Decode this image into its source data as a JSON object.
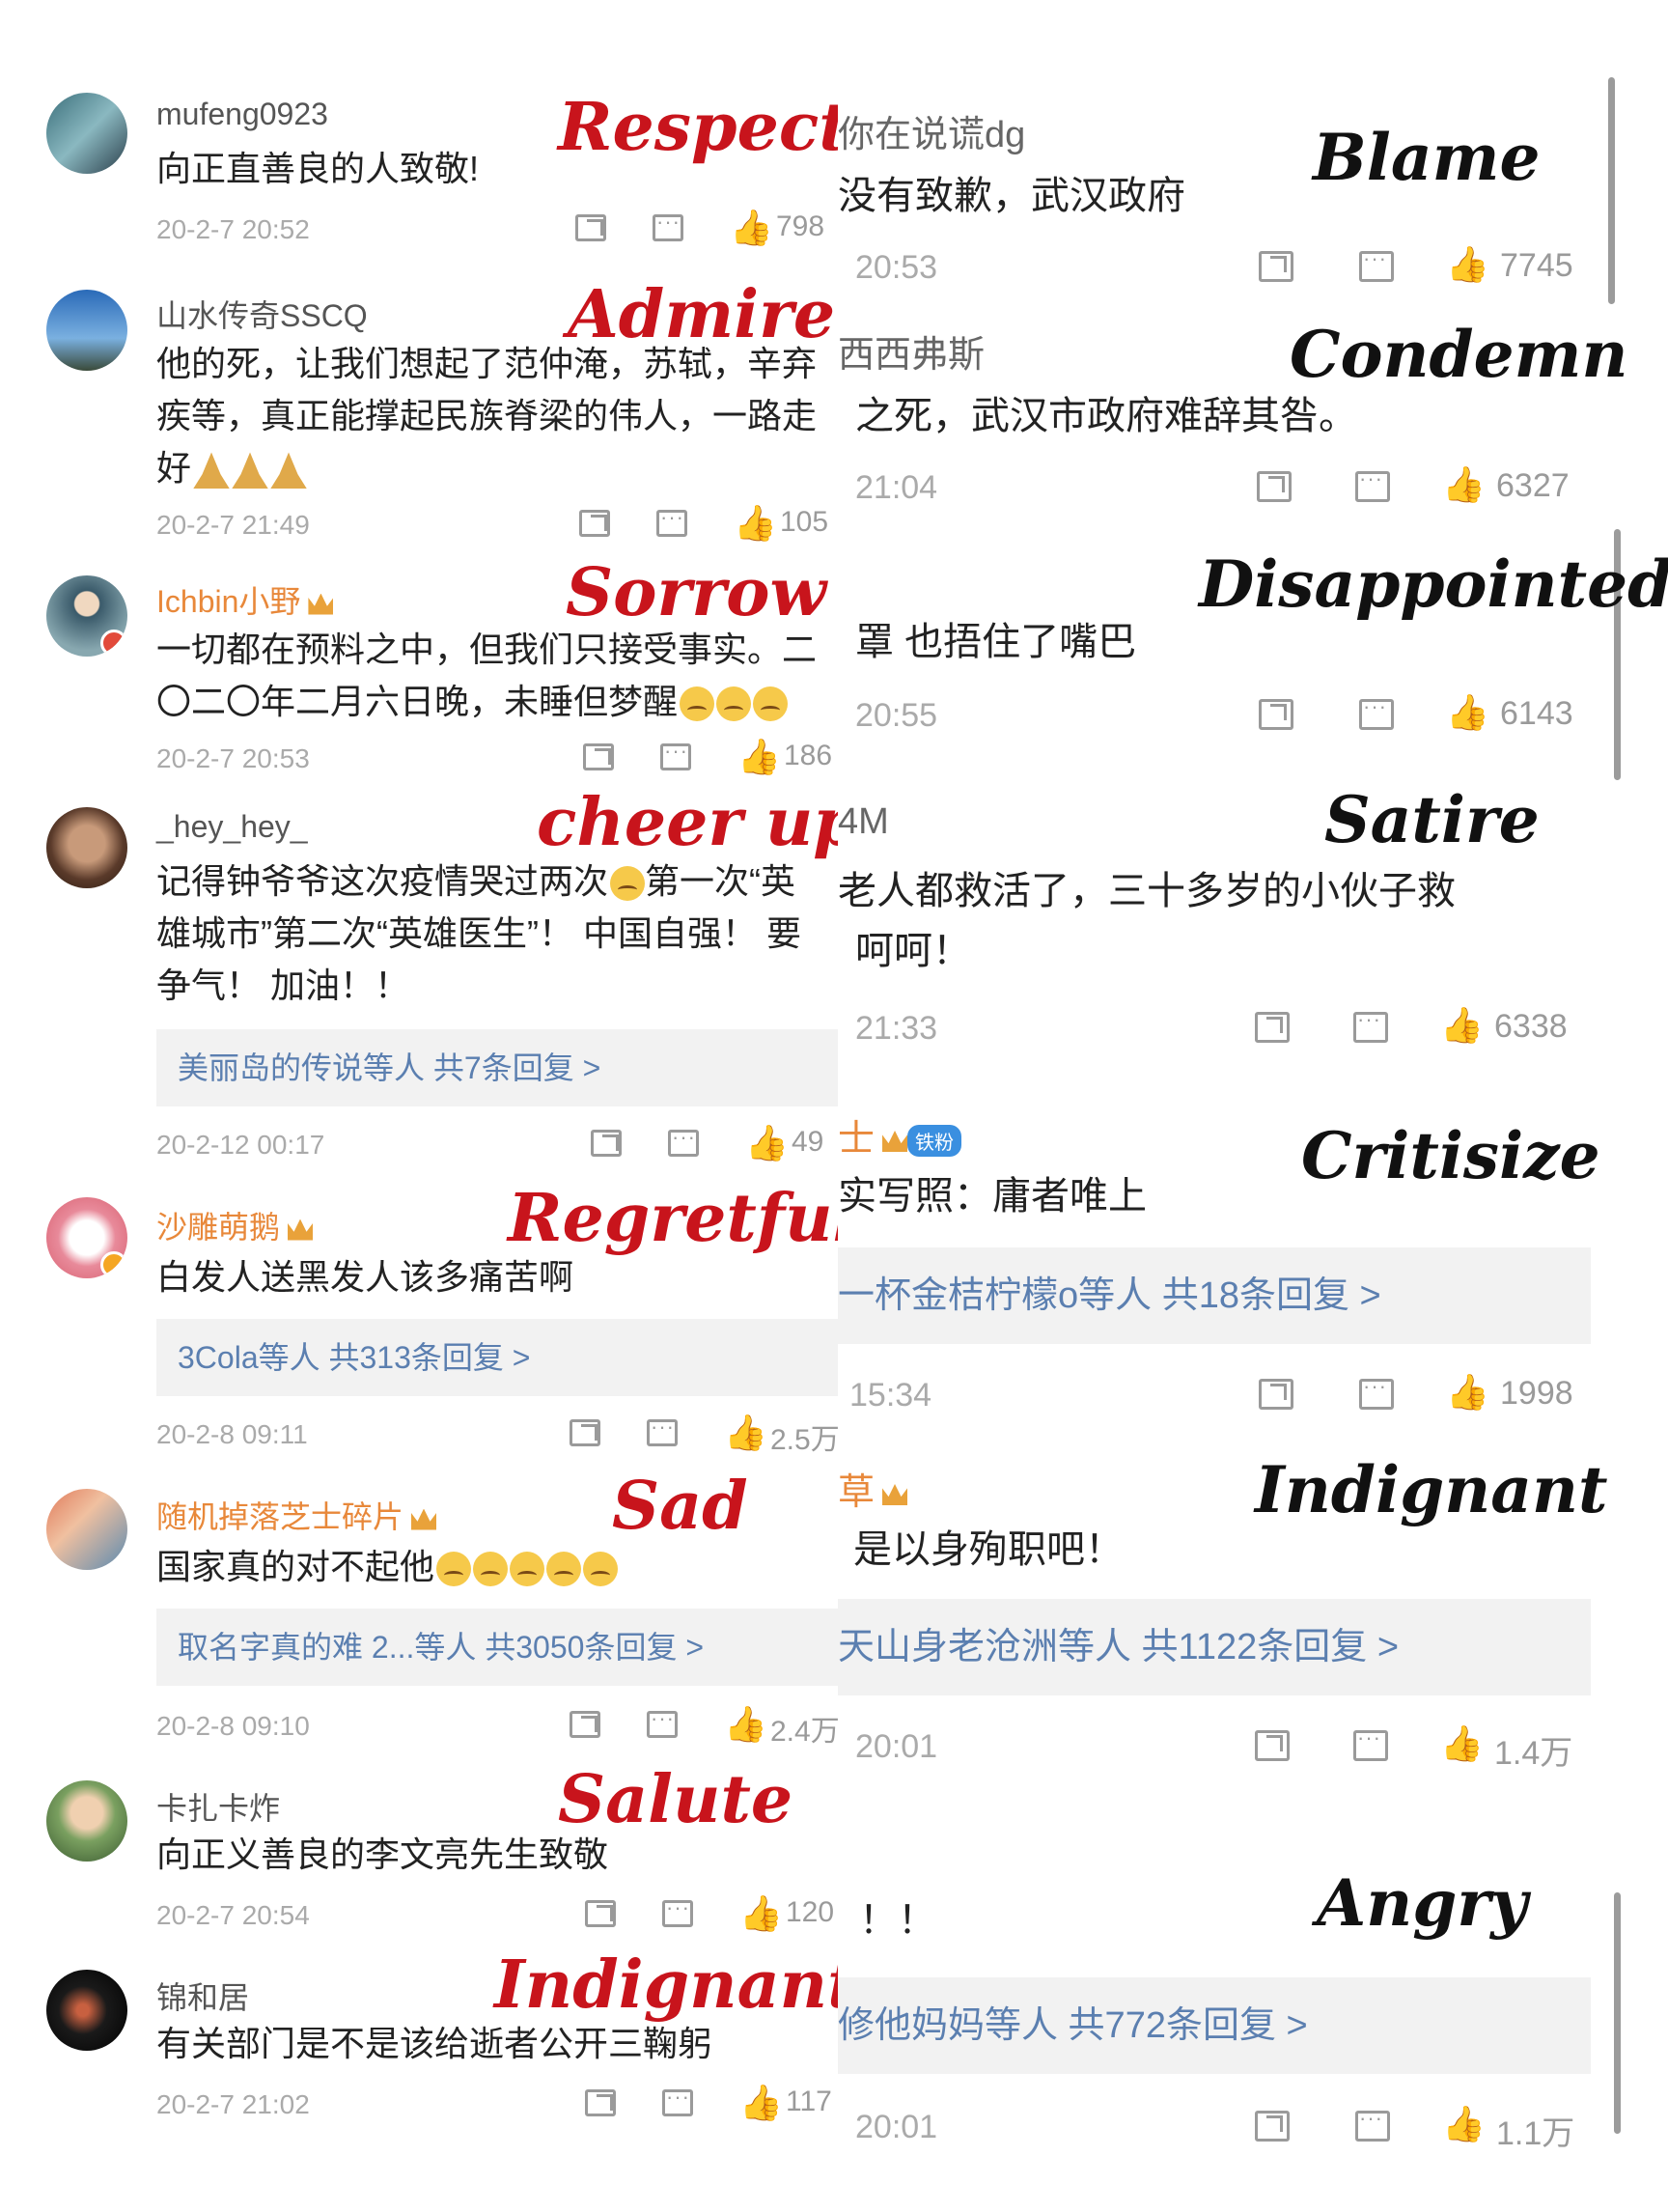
{
  "left": {
    "comments": [
      {
        "username": "mufeng0923",
        "text": "向正直善良的人致敬!",
        "time": "20-2-7 20:52",
        "likes": "798",
        "label": "Respect"
      },
      {
        "username": "山水传奇SSCQ",
        "text1": "他的死，让我们想起了范仲淹，苏轼，辛弃",
        "text2": "疾等，真正能撑起民族脊梁的伟人，一路走",
        "text3": "好",
        "time": "20-2-7 21:49",
        "likes": "105",
        "label": "Admire"
      },
      {
        "username": "Ichbin小野",
        "text1": "一切都在预料之中，但我们只接受事实。二",
        "text2": "〇二〇年二月六日晚，未睡但梦醒",
        "time": "20-2-7 20:53",
        "likes": "186",
        "label": "Sorrow"
      },
      {
        "username": "_hey_hey_",
        "text1": "记得钟爷爷这次疫情哭过两次",
        "text1b": "第一次“英",
        "text2": "雄城市”第二次“英雄医生”！ 中国自强！ 要",
        "text3": "争气！ 加油！！",
        "reply": "美丽岛的传说等人  共7条回复 >",
        "time": "20-2-12 00:17",
        "likes": "49",
        "label": "cheer up"
      },
      {
        "username": "沙雕萌鹅",
        "text": "白发人送黑发人该多痛苦啊",
        "reply": "3Cola等人  共313条回复 >",
        "time": "20-2-8 09:11",
        "likes": "2.5万",
        "label": "Regretful"
      },
      {
        "username": "随机掉落芝士碎片",
        "text": "国家真的对不起他",
        "reply": "取名字真的难 2...等人  共3050条回复 >",
        "time": "20-2-8 09:10",
        "likes": "2.4万",
        "label": "Sad"
      },
      {
        "username": "卡扎卡炸",
        "text": "向正义善良的李文亮先生致敬",
        "time": "20-2-7 20:54",
        "likes": "120",
        "label": "Salute"
      },
      {
        "username": "锦和居",
        "text": "有关部门是不是该给逝者公开三鞠躬",
        "time": "20-2-7 21:02",
        "likes": "117",
        "label": "Indignant"
      }
    ]
  },
  "right": {
    "comments": [
      {
        "username": "你在说谎dg",
        "text": "没有致歉，武汉政府",
        "time": "20:53",
        "likes": "7745",
        "label": "Blame"
      },
      {
        "username": "西西弗斯",
        "text": "之死，武汉市政府难辞其咎。",
        "time": "21:04",
        "likes": "6327",
        "label": "Condemn"
      },
      {
        "username": "",
        "text": "罩 也捂住了嘴巴",
        "time": "20:55",
        "likes": "6143",
        "label": "Disappointed"
      },
      {
        "username": "4M",
        "text1": "老人都救活了，三十多岁的小伙子救",
        "text2": "呵呵！",
        "time": "21:33",
        "likes": "6338",
        "label": "Satire"
      },
      {
        "username": "士",
        "fanbadge": "铁粉",
        "text": "实写照：庸者唯上",
        "reply": "一杯金桔柠檬o等人  共18条回复 >",
        "time": "15:34",
        "likes": "1998",
        "label": "Critisize"
      },
      {
        "username": "草",
        "text": "是以身殉职吧！",
        "reply": "天山身老沧洲等人  共1122条回复 >",
        "time": "20:01",
        "likes": "1.4万",
        "label": "Indignant"
      },
      {
        "username": "",
        "text": "！！",
        "reply": "修他妈妈等人  共772条回复 >",
        "time": "20:01",
        "likes": "1.1万",
        "label": "Angry"
      }
    ]
  },
  "icons": {
    "repost": "repost-icon",
    "comment": "comment-icon",
    "like": "thumbs-up-icon"
  },
  "colors": {
    "label_red": "#c8141c",
    "label_black": "#111111",
    "username_orange": "#e8883a",
    "reply_blue": "#5b7fb0"
  }
}
